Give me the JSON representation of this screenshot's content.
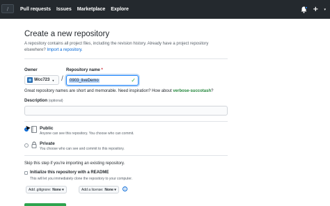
{
  "header": {
    "search_glyph": "/",
    "nav": [
      "Pull requests",
      "Issues",
      "Marketplace",
      "Explore"
    ],
    "plus": "+",
    "caret": "▾",
    "bg_color": "#24292e"
  },
  "page": {
    "title": "Create a new repository",
    "intro_text": "A repository contains all project files, including the revision history. Already have a project repository elsewhere? ",
    "import_link": "Import a repository."
  },
  "form": {
    "owner_label": "Owner",
    "owner_value": "Wcc723",
    "slash": "/",
    "repo_label": "Repository name",
    "required_mark": "*",
    "repo_value": "0903_liveDemo",
    "hint_text": "Great repository names are short and memorable. Need inspiration? How about ",
    "hint_suggestion": "verbose-succotash",
    "hint_end": "?",
    "description_label": "Description",
    "description_optional": "(optional)",
    "description_value": ""
  },
  "visibility": {
    "public_title": "Public",
    "public_desc": "Anyone can see this repository. You choose who can commit.",
    "private_title": "Private",
    "private_desc": "You choose who can see and commit to this repository.",
    "selected": "public"
  },
  "init": {
    "skip_text": "Skip this step if you're importing an existing repository.",
    "readme_title": "Initialize this repository with a README",
    "readme_desc": "This will let you immediately clone the repository to your computer.",
    "gitignore_label": "Add .gitignore:",
    "gitignore_value": "None ▾",
    "license_label": "Add a license:",
    "license_value": "None ▾",
    "info_glyph": "i"
  },
  "colors": {
    "link": "#0366d6",
    "suggestion": "#22863a",
    "create_button": "#2ea44f",
    "required": "#cb2431"
  }
}
